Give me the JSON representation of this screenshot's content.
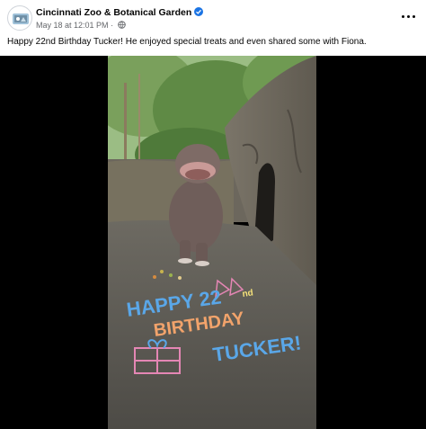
{
  "post": {
    "page_name": "Cincinnati Zoo & Botanical Garden",
    "date": "May 18 at 12:01 PM",
    "separator": "·",
    "caption": "Happy 22nd Birthday Tucker! He enjoyed special treats and even shared some with Fiona.",
    "icons": {
      "verified": "verified-badge-icon",
      "audience": "globe-icon",
      "more": "more-options-icon"
    }
  },
  "video": {
    "chalk_line1": "HAPPY 22",
    "chalk_superscript": "nd",
    "chalk_line2": "BIRTHDAY",
    "chalk_line3": "TUCKER!"
  },
  "colors": {
    "verified": "#1b74e4",
    "secondary_text": "#65676b",
    "chalk_blue": "#5aa7e8",
    "chalk_orange": "#f2a36b",
    "chalk_pink": "#e486b4"
  }
}
